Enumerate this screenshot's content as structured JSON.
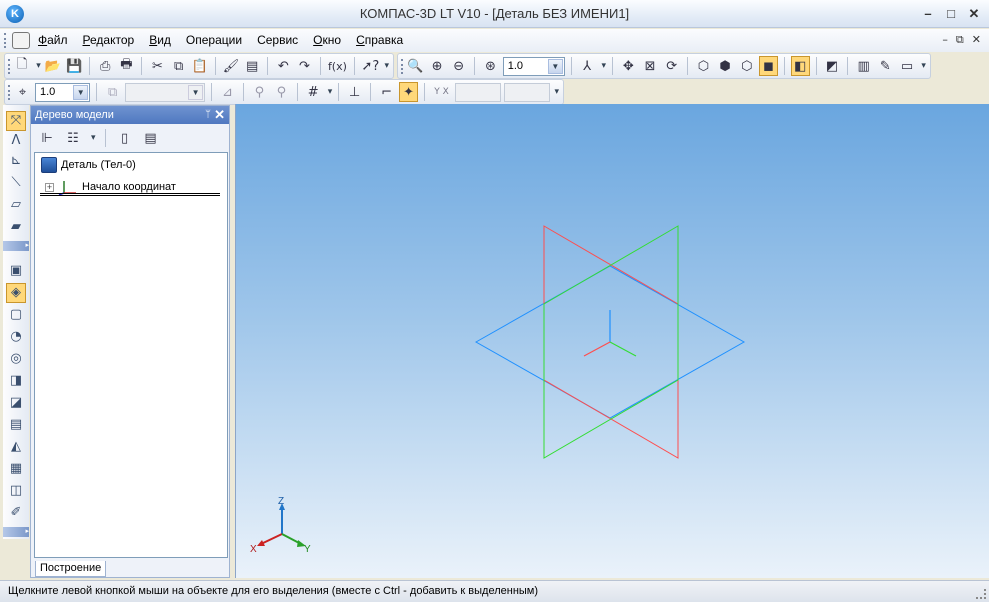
{
  "window": {
    "title": "КОМПАС-3D LT V10 - [Деталь БЕЗ ИМЕНИ1]",
    "app_logo_icon": "kompas-logo-icon",
    "minimize": "–",
    "maximize": "□",
    "close": "✕"
  },
  "menu": {
    "items": [
      {
        "label": "Файл",
        "u": "Ф",
        "rest": "айл"
      },
      {
        "label": "Редактор",
        "u": "Р",
        "rest": "едактор"
      },
      {
        "label": "Вид",
        "u": "В",
        "rest": "ид"
      },
      {
        "label": "Операции",
        "u": "",
        "rest": "Операции"
      },
      {
        "label": "Сервис",
        "u": "",
        "rest": "Сервис"
      },
      {
        "label": "Окно",
        "u": "О",
        "rest": "кно"
      },
      {
        "label": "Справка",
        "u": "С",
        "rest": "правка"
      }
    ],
    "mdi": {
      "minimize": "–",
      "restore": "⧉",
      "close": "✕"
    }
  },
  "toolbar_standard": {
    "zoom_value": "1.0",
    "fx_label": "f(x)"
  },
  "toolbar_current_state": {
    "step_value": "1.0",
    "layer_value": "",
    "coord_label": "Y X",
    "coord_x": "",
    "coord_y": ""
  },
  "model_tree": {
    "title": "Дерево модели",
    "pin": "ᛘ",
    "close": "✕",
    "root_label": "Деталь (Тел-0)",
    "child_label": "Начало координат",
    "tab_label": "Построение"
  },
  "viewport": {
    "triad": {
      "x": "X",
      "y": "Y",
      "z": "Z"
    },
    "colors": {
      "plane_xy": "#1e90ff",
      "plane_zx": "#ff4d4d",
      "plane_zy": "#33dd33"
    }
  },
  "status": {
    "text": "Щелкните левой кнопкой мыши на объекте для его выделения (вместе с Ctrl - добавить к выделенным)"
  }
}
